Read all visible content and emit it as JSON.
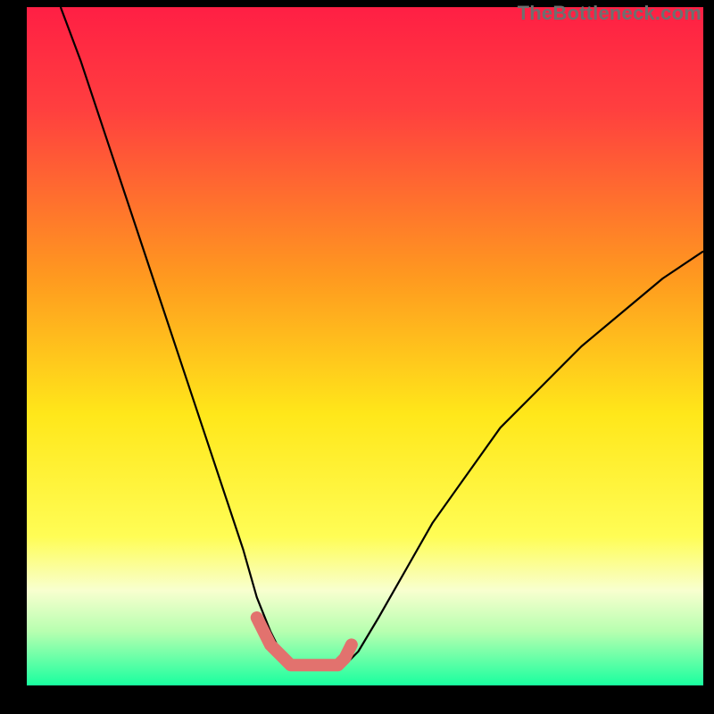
{
  "watermark": "TheBottleneck.com",
  "chart_data": {
    "type": "line",
    "title": "",
    "xlabel": "",
    "ylabel": "",
    "ylim": [
      0,
      100
    ],
    "xlim": [
      0,
      100
    ],
    "gradient_stops": [
      {
        "offset": 0,
        "color": "#ff1f44"
      },
      {
        "offset": 15,
        "color": "#ff3f3f"
      },
      {
        "offset": 40,
        "color": "#ff9a1f"
      },
      {
        "offset": 60,
        "color": "#ffe71a"
      },
      {
        "offset": 78,
        "color": "#fffd55"
      },
      {
        "offset": 86,
        "color": "#f8ffcf"
      },
      {
        "offset": 92,
        "color": "#b8ffb0"
      },
      {
        "offset": 100,
        "color": "#19ff9f"
      }
    ],
    "series": [
      {
        "name": "left-curve",
        "color": "#000000",
        "stroke_width": 2.2,
        "x": [
          5,
          8,
          11,
          14,
          17,
          20,
          23,
          26,
          29,
          32,
          34,
          36,
          38,
          39
        ],
        "y": [
          100,
          92,
          83,
          74,
          65,
          56,
          47,
          38,
          29,
          20,
          13,
          8,
          4,
          3
        ]
      },
      {
        "name": "right-curve",
        "color": "#000000",
        "stroke_width": 2.2,
        "x": [
          47,
          49,
          52,
          56,
          60,
          65,
          70,
          76,
          82,
          88,
          94,
          100
        ],
        "y": [
          3,
          5,
          10,
          17,
          24,
          31,
          38,
          44,
          50,
          55,
          60,
          64
        ]
      },
      {
        "name": "valley-highlight",
        "color": "#e2726e",
        "stroke_width": 14,
        "linecap": "round",
        "x": [
          34,
          36,
          38,
          39,
          40,
          42,
          44,
          46,
          47,
          48
        ],
        "y": [
          10,
          6,
          4,
          3,
          3,
          3,
          3,
          3,
          4,
          6
        ]
      }
    ]
  }
}
